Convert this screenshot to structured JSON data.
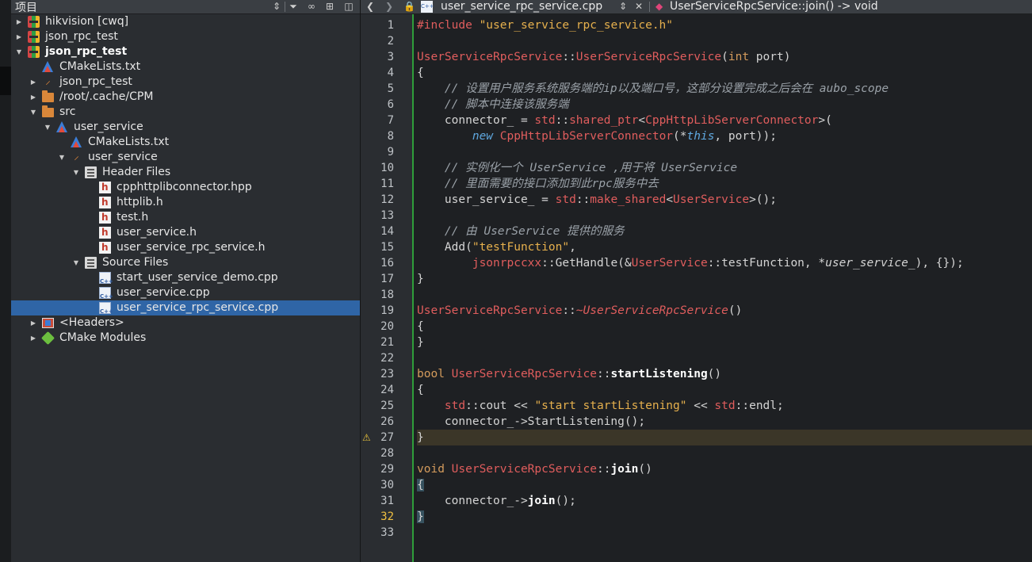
{
  "project_panel": {
    "title": "项目",
    "tree": [
      {
        "label": "hikvision [cwq]",
        "icon": "project-icon",
        "depth": 0,
        "expanded": false,
        "bold": false
      },
      {
        "label": "json_rpc_test",
        "icon": "project-icon",
        "depth": 0,
        "expanded": false,
        "bold": false
      },
      {
        "label": "json_rpc_test",
        "icon": "project-icon",
        "depth": 0,
        "expanded": true,
        "bold": true
      },
      {
        "label": "CMakeLists.txt",
        "icon": "cmake-icon",
        "depth": 1,
        "expanded": null,
        "bold": false
      },
      {
        "label": "json_rpc_test",
        "icon": "hammer-icon",
        "depth": 1,
        "expanded": false,
        "bold": false
      },
      {
        "label": "/root/.cache/CPM",
        "icon": "folder-icon",
        "depth": 1,
        "expanded": false,
        "bold": false
      },
      {
        "label": "src",
        "icon": "folder-icon",
        "depth": 1,
        "expanded": true,
        "bold": false
      },
      {
        "label": "user_service",
        "icon": "cmake-icon",
        "depth": 2,
        "expanded": true,
        "bold": false
      },
      {
        "label": "CMakeLists.txt",
        "icon": "cmake-icon",
        "depth": 3,
        "expanded": null,
        "bold": false
      },
      {
        "label": "user_service",
        "icon": "hammer-icon",
        "depth": 3,
        "expanded": true,
        "bold": false
      },
      {
        "label": "Header Files",
        "icon": "group-icon",
        "depth": 4,
        "expanded": true,
        "bold": false
      },
      {
        "label": "cpphttplibconnector.hpp",
        "icon": "header-file-icon",
        "depth": 5,
        "expanded": null,
        "bold": false
      },
      {
        "label": "httplib.h",
        "icon": "header-file-icon",
        "depth": 5,
        "expanded": null,
        "bold": false
      },
      {
        "label": "test.h",
        "icon": "header-file-icon",
        "depth": 5,
        "expanded": null,
        "bold": false
      },
      {
        "label": "user_service.h",
        "icon": "header-file-icon",
        "depth": 5,
        "expanded": null,
        "bold": false
      },
      {
        "label": "user_service_rpc_service.h",
        "icon": "header-file-icon",
        "depth": 5,
        "expanded": null,
        "bold": false
      },
      {
        "label": "Source Files",
        "icon": "group-icon",
        "depth": 4,
        "expanded": true,
        "bold": false
      },
      {
        "label": "start_user_service_demo.cpp",
        "icon": "cpp-file-icon",
        "depth": 5,
        "expanded": null,
        "bold": false
      },
      {
        "label": "user_service.cpp",
        "icon": "cpp-file-icon",
        "depth": 5,
        "expanded": null,
        "bold": false
      },
      {
        "label": "user_service_rpc_service.cpp",
        "icon": "cpp-file-icon",
        "depth": 5,
        "expanded": null,
        "bold": false,
        "selected": true
      },
      {
        "label": "<Headers>",
        "icon": "headers-folder-icon",
        "depth": 1,
        "expanded": false,
        "bold": false
      },
      {
        "label": "CMake Modules",
        "icon": "cmake-modules-icon",
        "depth": 1,
        "expanded": false,
        "bold": false
      }
    ]
  },
  "editor": {
    "file_tab": "user_service_rpc_service.cpp",
    "symbol": "UserServiceRpcService::join() -> void",
    "current_line": 32,
    "warning_line": 27,
    "lines": [
      "#include \"user_service_rpc_service.h\"",
      "",
      "UserServiceRpcService::UserServiceRpcService(int port)",
      "{",
      "    // 设置用户服务系统服务端的ip以及端口号，这部分设置完成之后会在 aubo_scope",
      "    // 脚本中连接该服务端",
      "    connector_ = std::shared_ptr<CppHttpLibServerConnector>(",
      "        new CppHttpLibServerConnector(*this, port));",
      "",
      "    // 实例化一个 UserService ,用于将 UserService",
      "    // 里面需要的接口添加到此rpc服务中去",
      "    user_service_ = std::make_shared<UserService>();",
      "",
      "    // 由 UserService 提供的服务",
      "    Add(\"testFunction\",",
      "        jsonrpccxx::GetHandle(&UserService::testFunction, *user_service_), {});",
      "}",
      "",
      "UserServiceRpcService::~UserServiceRpcService()",
      "{",
      "}",
      "",
      "bool UserServiceRpcService::startListening()",
      "{",
      "    std::cout << \"start startListening\" << std::endl;",
      "    connector_->StartListening();",
      "}",
      "",
      "void UserServiceRpcService::join()",
      "{",
      "    connector_->join();",
      "}",
      ""
    ],
    "fold_lines": [
      3,
      19,
      23,
      29
    ]
  }
}
